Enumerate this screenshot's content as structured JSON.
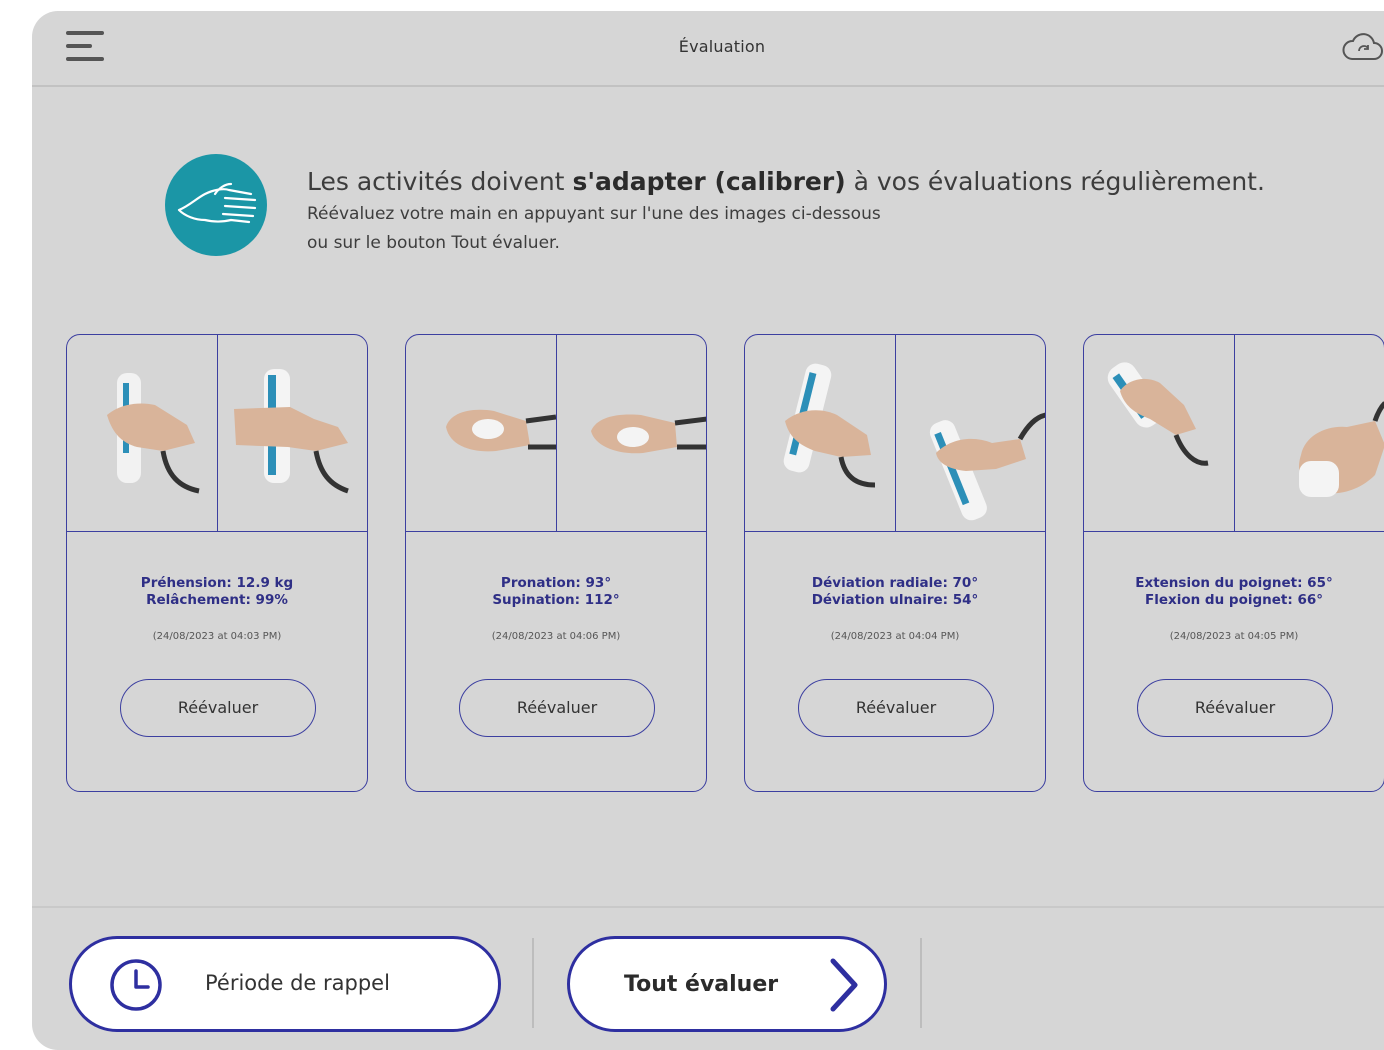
{
  "header": {
    "title": "Évaluation",
    "menu_icon": "hamburger-menu-icon",
    "sync_icon": "cloud-sync-icon"
  },
  "banner": {
    "icon": "hand-icon",
    "title_prefix": "Les activités doivent ",
    "title_bold": "s'adapter (calibrer)",
    "title_suffix": " à vos évaluations régulièrement.",
    "line1": "Réévaluez votre main en appuyant sur l'une des images ci-dessous",
    "line2": "ou sur le bouton Tout évaluer."
  },
  "cards": [
    {
      "line1": "Préhension: 12.9 kg",
      "line2": "Relâchement: 99%",
      "timestamp": "(24/08/2023 at 04:03 PM)",
      "button": "Réévaluer"
    },
    {
      "line1": "Pronation: 93°",
      "line2": "Supination: 112°",
      "timestamp": "(24/08/2023 at 04:06 PM)",
      "button": "Réévaluer"
    },
    {
      "line1": "Déviation radiale: 70°",
      "line2": "Déviation ulnaire: 54°",
      "timestamp": "(24/08/2023 at 04:04 PM)",
      "button": "Réévaluer"
    },
    {
      "line1": "Extension du poignet: 65°",
      "line2": "Flexion du poignet: 66°",
      "timestamp": "(24/08/2023 at 04:05 PM)",
      "button": "Réévaluer"
    }
  ],
  "footer": {
    "period_label": "Période de rappel",
    "period_icon": "clock-icon",
    "evaluate_all_label": "Tout évaluer",
    "evaluate_all_icon": "chevron-right-icon"
  },
  "colors": {
    "background": "#d6d6d6",
    "accent": "#2e2fa0",
    "teal": "#1b96a6"
  }
}
